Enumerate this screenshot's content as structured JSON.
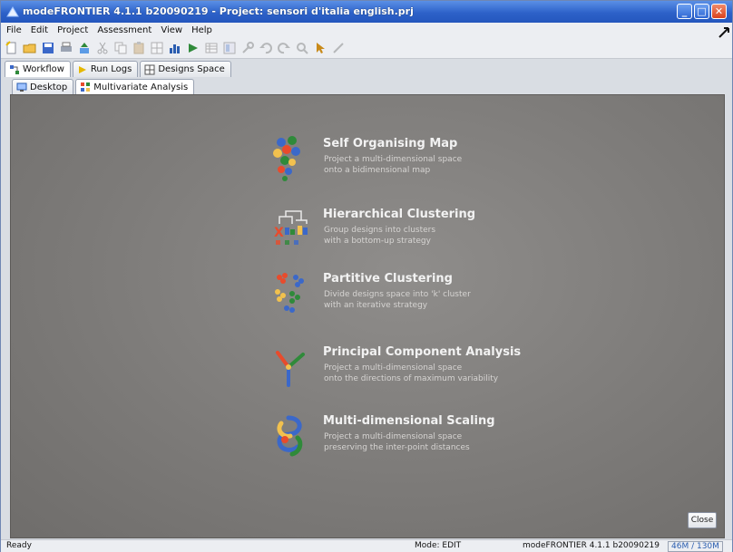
{
  "window": {
    "title": "modeFRONTIER 4.1.1 b20090219 - Project: sensori d'italia english.prj",
    "controls": [
      "_",
      "□",
      "✕"
    ]
  },
  "menu": [
    "File",
    "Edit",
    "Project",
    "Assessment",
    "View",
    "Help"
  ],
  "toolbar": {
    "icons": [
      "new-icon",
      "open-icon",
      "save-icon",
      "print-icon",
      "upload-icon",
      "cut-icon",
      "copy-icon",
      "paste-icon",
      "grid-icon",
      "chart-icon",
      "run-icon",
      "table-icon",
      "layout-icon",
      "tools-icon",
      "undo-icon",
      "redo-icon",
      "zoom-icon",
      "pointer-icon",
      "link-icon"
    ]
  },
  "perspective_tabs": [
    {
      "label": "Workflow",
      "icon": "workflow-icon"
    },
    {
      "label": "Run Logs",
      "icon": "runlogs-icon"
    },
    {
      "label": "Designs Space",
      "icon": "designs-space-icon"
    }
  ],
  "view_tabs": [
    {
      "label": "Desktop",
      "icon": "desktop-icon"
    },
    {
      "label": "Multivariate Analysis",
      "icon": "multivariate-icon"
    }
  ],
  "analyses": [
    {
      "title": "Self Organising Map",
      "desc1": "Project a multi-dimensional space",
      "desc2": "onto a bidimensional map",
      "icon": "som-icon"
    },
    {
      "title": "Hierarchical Clustering",
      "desc1": "Group designs into clusters",
      "desc2": "with a bottom-up strategy",
      "icon": "hierarchical-clustering-icon"
    },
    {
      "title": "Partitive Clustering",
      "desc1": "Divide designs space into 'k' cluster",
      "desc2": "with an iterative strategy",
      "icon": "partitive-clustering-icon"
    },
    {
      "title": "Principal Component Analysis",
      "desc1": "Project a multi-dimensional space",
      "desc2": "onto the directions of maximum variability",
      "icon": "pca-icon"
    },
    {
      "title": "Multi-dimensional Scaling",
      "desc1": "Project a multi-dimensional space",
      "desc2": "preserving the inter-point distances",
      "icon": "mds-icon"
    }
  ],
  "close_label": "Close",
  "status": {
    "ready": "Ready",
    "mode": "Mode: EDIT",
    "version": "modeFRONTIER 4.1.1 b20090219",
    "memory": "46M / 130M"
  }
}
